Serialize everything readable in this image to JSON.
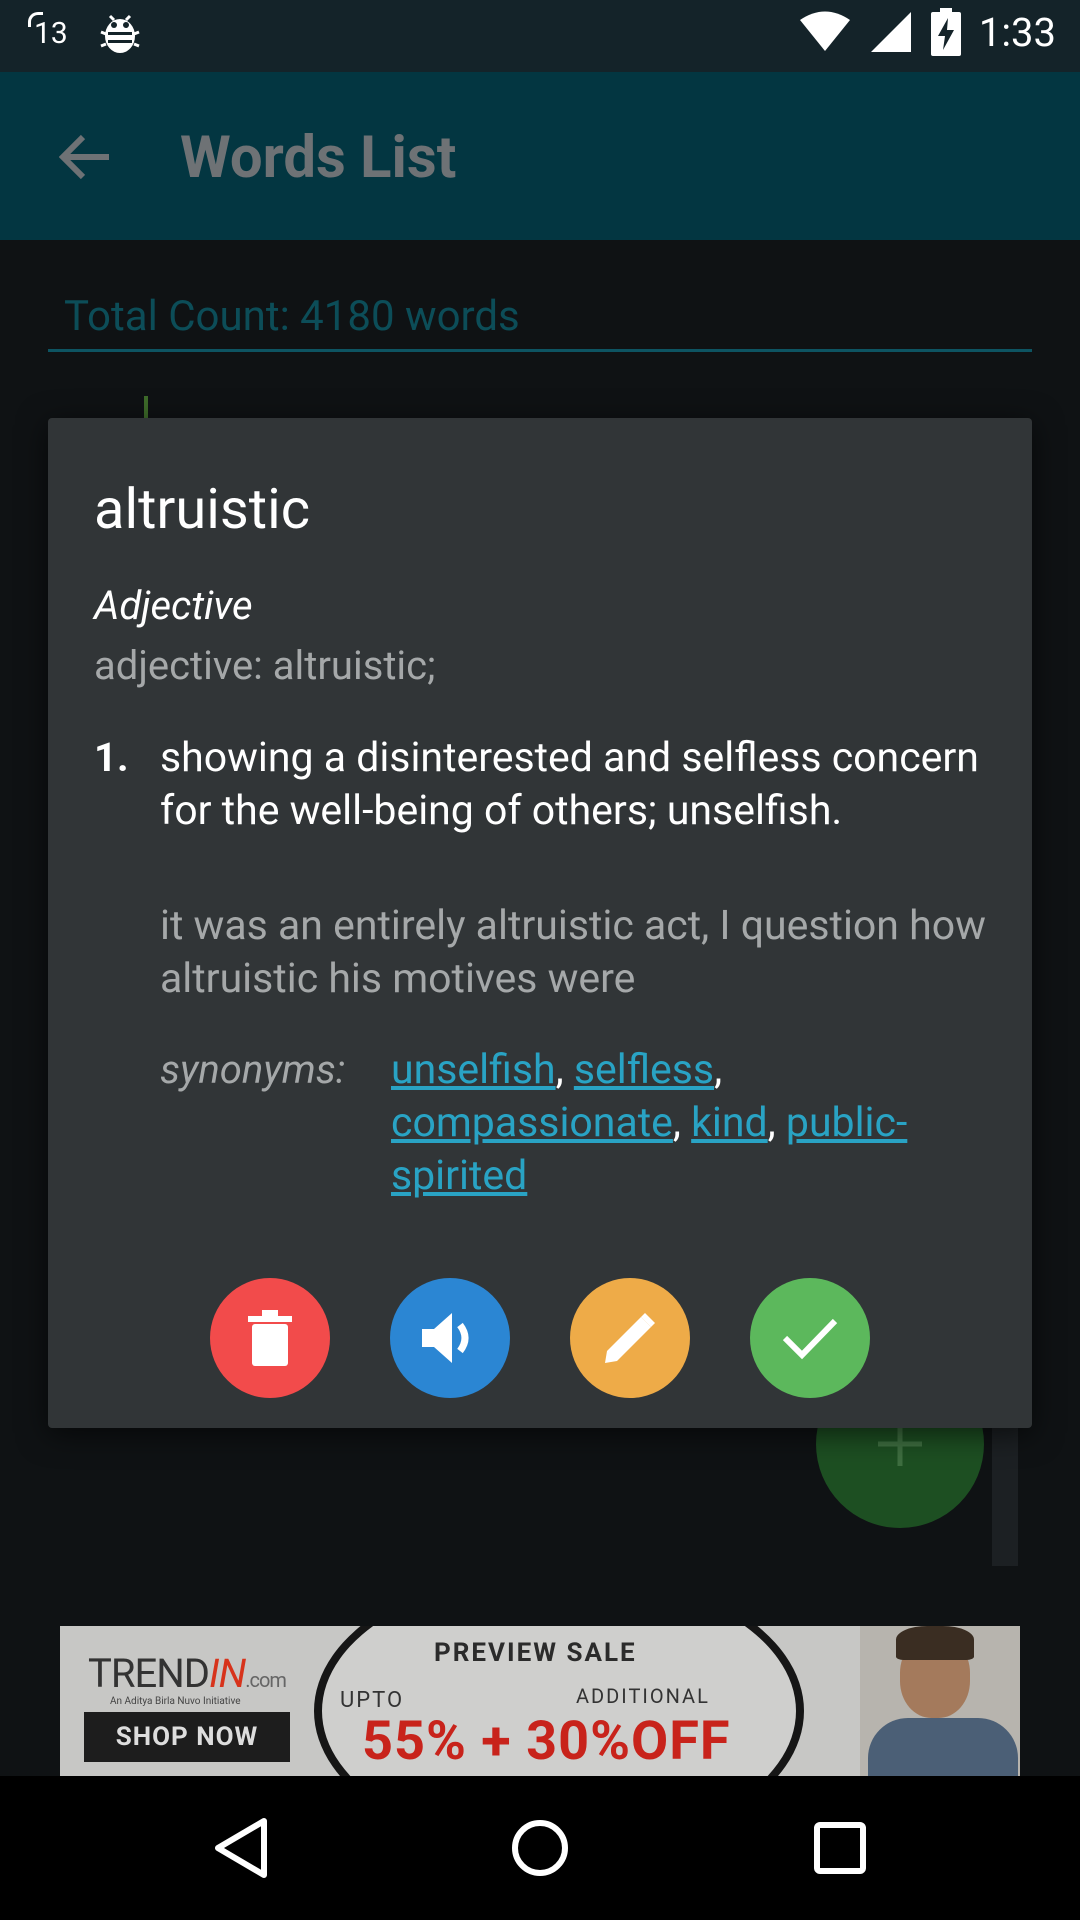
{
  "status_bar": {
    "notification_count": "13",
    "time": "1:33"
  },
  "app_bar": {
    "title": "Words List"
  },
  "list": {
    "total_count": "Total Count: 4180 words"
  },
  "dialog": {
    "word": "altruistic",
    "part_of_speech": "Adjective",
    "word_forms": "adjective: altruistic;",
    "definitions": [
      {
        "number": "1.",
        "text": "showing a disinterested and selfless concern for the well-being of others; unselfish.",
        "example": "it was an entirely altruistic act, I question how altruistic his motives were",
        "synonyms_label": "synonyms:",
        "synonyms": [
          "unselfish",
          "selfless",
          "compassionate",
          "kind",
          "public-spirited"
        ]
      }
    ],
    "actions": {
      "delete_icon": "trash-icon",
      "speak_icon": "speaker-icon",
      "edit_icon": "pencil-icon",
      "done_icon": "check-icon"
    },
    "colors": {
      "delete": "#f24b4b",
      "speak": "#2b86d3",
      "edit": "#eeab48",
      "done": "#5cb85c"
    }
  },
  "ad_banner": {
    "brand_main": "TREND",
    "brand_accent": "IN",
    "brand_suffix": ".com",
    "tagline": "An Aditya Birla Nuvo Initiative",
    "cta": "SHOP NOW",
    "headline": "PREVIEW SALE",
    "upto": "UPTO",
    "additional": "ADDITIONAL",
    "offer": "55% + 30%OFF"
  }
}
